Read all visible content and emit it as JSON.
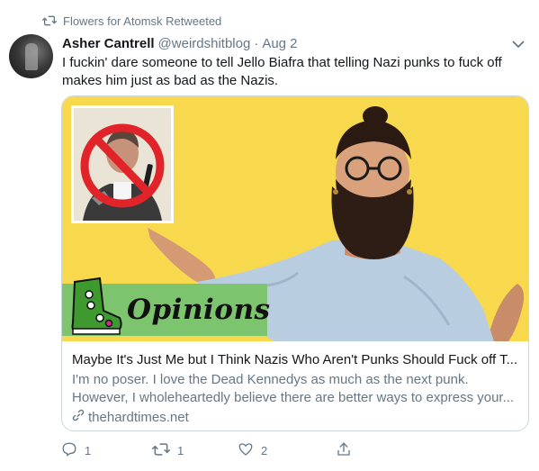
{
  "retweet": {
    "label": "Flowers for Atomsk Retweeted",
    "icon": "retweet-icon"
  },
  "tweet": {
    "display_name": "Asher Cantrell",
    "handle": "@weirdshitblog",
    "separator": "·",
    "date": "Aug 2",
    "text": "I fuckin' dare someone to tell Jello Biafra that telling Nazi punks to fuck off makes him just as bad as the Nazis."
  },
  "card": {
    "banner_word": "Opinions",
    "title": "Maybe It's Just Me but I Think Nazis Who Aren't Punks Should Fuck off T...",
    "description_line1": "I'm no poser. I love the Dead Kennedys as much as the next punk.",
    "description_line2": "However, I wholeheartedly believe there are better ways to express your...",
    "domain": "thehardtimes.net"
  },
  "actions": {
    "reply_count": "1",
    "retweet_count": "1",
    "like_count": "2"
  },
  "colors": {
    "secondary_text": "#657786",
    "card_border": "#ccd6dd",
    "banner_yellow": "#f8d94d",
    "opinions_green": "#7cc46d",
    "prohibition_red": "#e0242a"
  }
}
